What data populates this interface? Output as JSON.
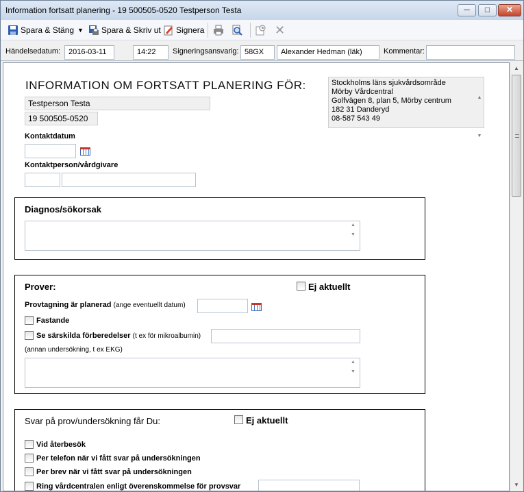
{
  "window": {
    "title": "Information fortsatt planering - 19 500505-0520 Testperson Testa",
    "minimize_icon": "minimize-icon",
    "maximize_icon": "maximize-icon",
    "close_icon": "close-icon"
  },
  "toolbar": {
    "save_close_label": "Spara & Stäng",
    "save_print_label": "Spara & Skriv ut",
    "sign_label": "Signera",
    "icons": [
      "save-icon",
      "dropdown-arrow-icon",
      "save-print-icon",
      "sign-icon",
      "printer-icon",
      "print-preview-icon",
      "attachment-icon",
      "delete-icon"
    ]
  },
  "infobar": {
    "event_date_label": "Händelsedatum:",
    "event_date": "2016-03-11",
    "event_time": "14:22",
    "signer_label": "Signeringsansvarig:",
    "signer_code": "58GX",
    "signer_name": "Alexander Hedman (läk)",
    "comment_label": "Kommentar:",
    "comment_value": ""
  },
  "document": {
    "heading": "INFORMATION OM FORTSATT PLANERING FÖR:",
    "patient_name": "Testperson Testa",
    "patient_id": "19 500505-0520",
    "address_lines": [
      "Stockholms läns sjukvårdsområde",
      "Mörby Vårdcentral",
      "Golfvägen 8, plan 5, Mörby centrum",
      "182 31 Danderyd",
      "08-587 543 49"
    ],
    "contact_date_label": "Kontaktdatum",
    "contact_person_label": "Kontaktperson/vårdgivare",
    "diagnosis": {
      "title": "Diagnos/sökorsak"
    },
    "samples": {
      "title": "Prover:",
      "not_applicable": "Ej aktuellt",
      "planned_label": "Provtagning är planerad",
      "planned_note": "(ange eventuellt datum)",
      "fasting_label": "Fastande",
      "special_label": "Se särskilda förberedelser",
      "special_note": "(t ex för mikroalbumin)",
      "other_note": "(annan undersökning, t ex EKG)"
    },
    "results": {
      "title": "Svar på prov/undersökning får Du:",
      "not_applicable": "Ej aktuellt",
      "options": [
        "Vid återbesök",
        "Per telefon när vi fått svar på undersökningen",
        "Per brev när vi fått svar på undersökningen",
        "Ring vårdcentralen enligt överenskommelse för provsvar"
      ]
    }
  },
  "colors": {
    "accent": "#3a64b8",
    "title_bar": "#c6d6ea",
    "close_button": "#c7442b"
  }
}
